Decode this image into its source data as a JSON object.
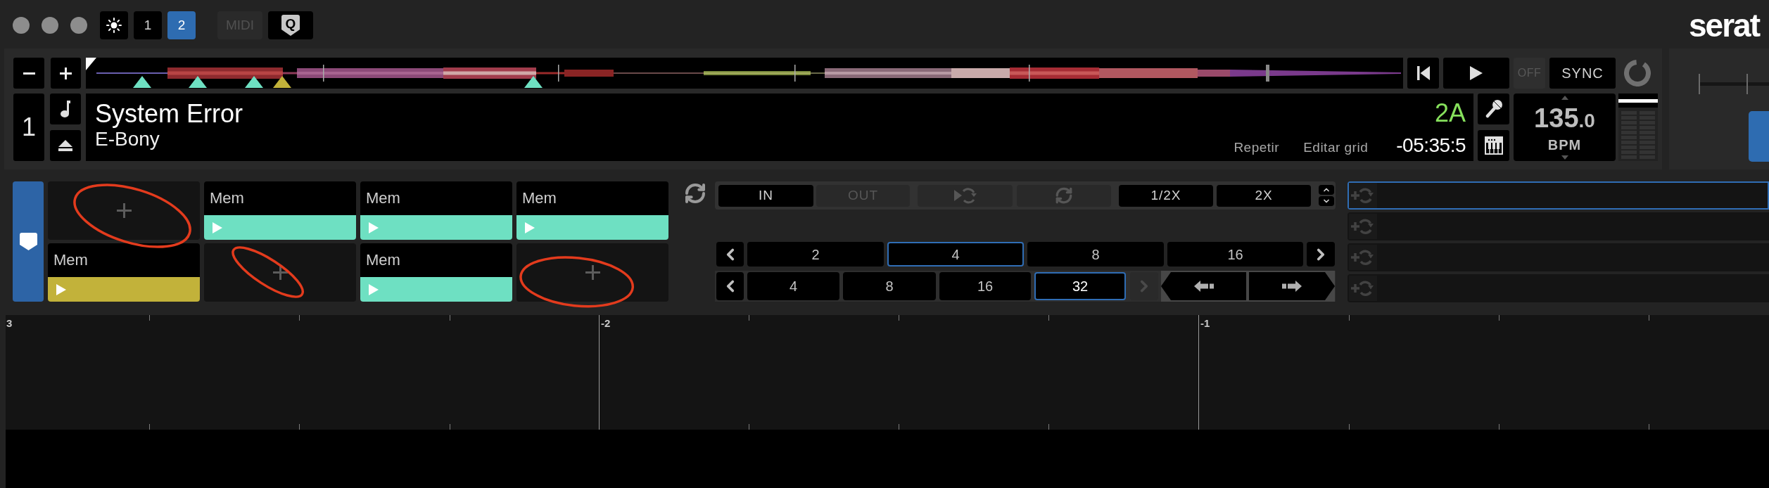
{
  "toolbar": {
    "deck_buttons": [
      {
        "label": "1",
        "selected": false
      },
      {
        "label": "2",
        "selected": true
      }
    ],
    "midi_button": {
      "label": "MIDI",
      "active": false
    },
    "quantize_button": {
      "label": "Q"
    },
    "logo": "serat"
  },
  "deck": {
    "number": "1",
    "overview": {
      "markers": [
        {
          "color": "#6ee0c2"
        },
        {
          "color": "#6ee0c2"
        },
        {
          "color": "#6ee0c2"
        },
        {
          "color": "#c2b23a"
        },
        {
          "color": "#6ee0c2"
        }
      ]
    },
    "off_button": {
      "label": "OFF",
      "active": false
    },
    "sync_button": {
      "label": "SYNC"
    },
    "track": {
      "title": "System Error",
      "artist": "E-Bony",
      "key": "2A",
      "actions": [
        "Repetir",
        "Editar grid"
      ],
      "time": "-05:35:5"
    },
    "bpm": {
      "integer": "135",
      "decimal": ".0",
      "unit": "BPM"
    },
    "meter": {
      "level": 0
    }
  },
  "cues": {
    "pads": [
      {
        "kind": "empty",
        "circled": true
      },
      {
        "kind": "cue",
        "label": "Mem",
        "color": "#6ee0c2",
        "circled": false
      },
      {
        "kind": "cue",
        "label": "Mem",
        "color": "#6ee0c2",
        "circled": false
      },
      {
        "kind": "cue",
        "label": "Mem",
        "color": "#6ee0c2",
        "circled": false
      },
      {
        "kind": "cue",
        "label": "Mem",
        "color": "#c2b23a",
        "circled": false
      },
      {
        "kind": "empty",
        "circled": true
      },
      {
        "kind": "cue",
        "label": "Mem",
        "color": "#6ee0c2",
        "circled": false
      },
      {
        "kind": "empty",
        "circled": true
      }
    ]
  },
  "loops": {
    "top_buttons": [
      {
        "kind": "text",
        "label": "IN",
        "disabled": false
      },
      {
        "kind": "text",
        "label": "OUT",
        "disabled": true
      },
      {
        "kind": "roll",
        "disabled": true
      },
      {
        "kind": "reloop",
        "disabled": true
      },
      {
        "kind": "text",
        "label": "1/2X",
        "disabled": false
      },
      {
        "kind": "text",
        "label": "2X",
        "disabled": false
      }
    ],
    "beat_row": {
      "prev_disabled": false,
      "next_disabled": false,
      "options": [
        {
          "label": "2",
          "selected": false
        },
        {
          "label": "4",
          "selected": true
        },
        {
          "label": "8",
          "selected": false
        },
        {
          "label": "16",
          "selected": false
        }
      ]
    },
    "jump_row": {
      "prev_disabled": false,
      "next_disabled": true,
      "options": [
        {
          "label": "4",
          "selected": false
        },
        {
          "label": "8",
          "selected": false
        },
        {
          "label": "16",
          "selected": false
        },
        {
          "label": "32",
          "selected": true
        }
      ]
    },
    "slots": [
      {
        "selected": true
      },
      {
        "selected": false
      },
      {
        "selected": false
      },
      {
        "selected": false
      }
    ]
  },
  "timeline": {
    "labels": [
      "3",
      "-2",
      "-1"
    ]
  }
}
